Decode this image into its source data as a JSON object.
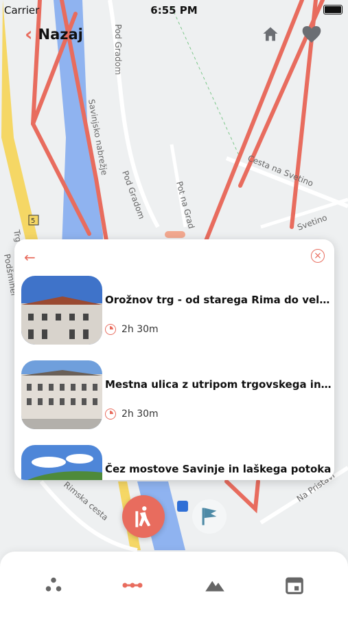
{
  "status_bar": {
    "carrier": "Carrier",
    "time": "6:55 PM"
  },
  "header": {
    "back_label": "Nazaj",
    "icons": [
      "home-icon",
      "heart-icon"
    ]
  },
  "map": {
    "streets": [
      "Pod Gradom",
      "Savinjsko nabrežje",
      "Pod Gradom",
      "Pot na Grad",
      "Cesta na Svetino",
      "Svetino",
      "Trg",
      "Podšmihel",
      "Rimska cesta",
      "Na Pristavi",
      "5"
    ],
    "route_color": "#e86c5e"
  },
  "sheet": {
    "routes": [
      {
        "title": "Orožnov trg - od starega Rima do velikeg...",
        "duration": "2h 30m"
      },
      {
        "title": "Mestna ulica z utripom trgovskega in ...",
        "duration": "2h 30m"
      },
      {
        "title": "Čez mostove Savinje in laškega potoka",
        "duration": ""
      }
    ]
  },
  "tabbar": {
    "tabs": [
      "nearby-icon",
      "routes-icon",
      "mountain-icon",
      "calendar-icon"
    ],
    "active_index": 1
  },
  "colors": {
    "accent": "#e86c5e",
    "river": "#8fb3f0",
    "road": "#f5d765"
  }
}
